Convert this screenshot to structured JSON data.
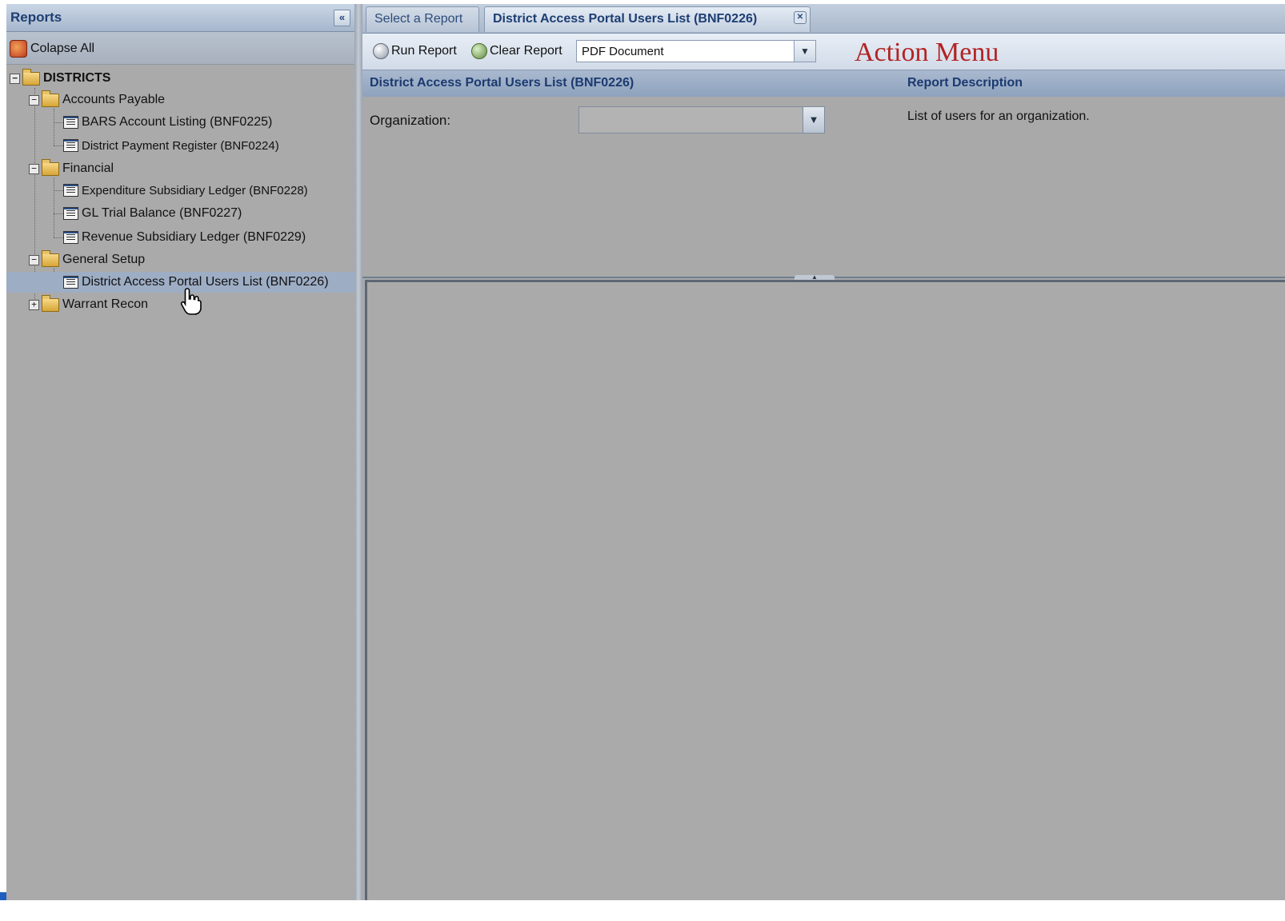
{
  "left_panel": {
    "title": "Reports",
    "collapse_all_label": "Colapse All",
    "tree": {
      "root": "DISTRICTS",
      "groups": [
        {
          "label": "Accounts Payable",
          "expanded": true,
          "items": [
            "BARS Account Listing (BNF0225)",
            "District Payment Register (BNF0224)"
          ]
        },
        {
          "label": "Financial",
          "expanded": true,
          "items": [
            "Expenditure Subsidiary Ledger (BNF0228)",
            "GL Trial Balance (BNF0227)",
            "Revenue Subsidiary Ledger (BNF0229)"
          ]
        },
        {
          "label": "General Setup",
          "expanded": true,
          "items": [
            "District Access Portal Users List (BNF0226)"
          ]
        },
        {
          "label": "Warrant Recon",
          "expanded": false,
          "items": []
        }
      ],
      "selected": "District Access Portal Users List (BNF0226)"
    }
  },
  "tabs": [
    {
      "label": "Select a Report",
      "active": false
    },
    {
      "label": "District Access Portal Users List (BNF0226)",
      "active": true
    }
  ],
  "action_bar": {
    "run_label": "Run Report",
    "clear_label": "Clear Report",
    "format_value": "PDF Document",
    "annotation": "Action Menu"
  },
  "report_form": {
    "title": "District Access Portal Users List (BNF0226)",
    "description_title": "Report Description",
    "description": "List of users for an organization.",
    "org_label": "Organization:",
    "org_value": ""
  },
  "colors": {
    "panel_bg": "#a9a9a9",
    "header_text": "#1e3f73",
    "annotation": "#b32424",
    "selection": "#9dadc4"
  }
}
